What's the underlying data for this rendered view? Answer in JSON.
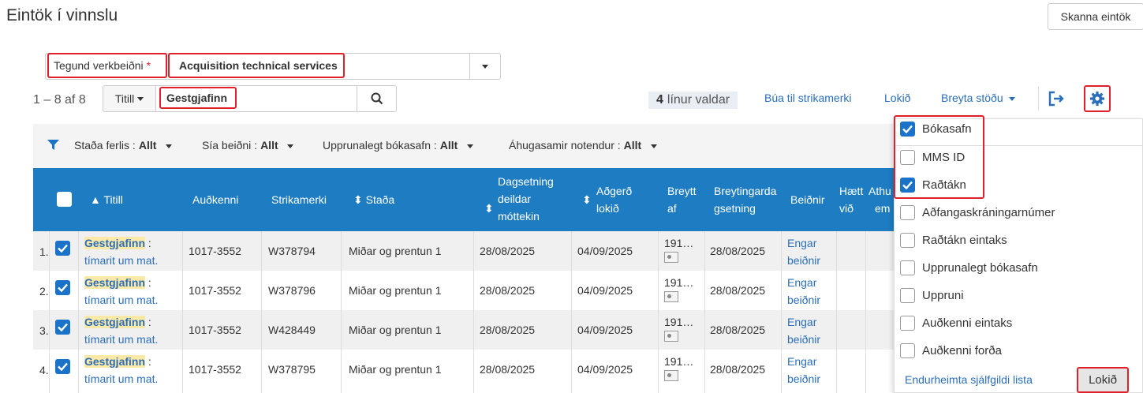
{
  "page_title": "Eintök í vinnslu",
  "scan_button": "Skanna eintök",
  "request_type": {
    "label": "Tegund verkbeiðni",
    "required": "*",
    "value": "Acquisition technical services"
  },
  "count": "1 – 8 af 8",
  "search": {
    "type": "Titill",
    "value": "Gestgjafinn"
  },
  "selected": {
    "num": "4",
    "text": "línur valdar"
  },
  "actions": {
    "barcode": "Búa til strikamerki",
    "done": "Lokið",
    "status": "Breyta stöðu"
  },
  "filters": [
    {
      "label": "Staða ferlis :",
      "value": "Allt"
    },
    {
      "label": "Sía beiðni :",
      "value": "Allt"
    },
    {
      "label": "Upprunalegt bókasafn :",
      "value": "Allt"
    },
    {
      "label": "Áhugasamir notendur :",
      "value": "Allt"
    }
  ],
  "columns": {
    "title": "Titill",
    "id": "Auðkenni",
    "barcode": "Strikamerki",
    "status": "Staða",
    "date1": [
      "Dagsetning",
      "deildar",
      "móttekin"
    ],
    "date2": [
      "Aðgerð",
      "lokið"
    ],
    "changed_by": [
      "Breytt",
      "af"
    ],
    "change_date": [
      "Breytingarda",
      "gsetning"
    ],
    "requests": "Beiðnir",
    "stopped": [
      "Hætt",
      "við"
    ],
    "notes": [
      "Athu",
      "em"
    ]
  },
  "rows": [
    {
      "num": "1.",
      "title_hl": "Gestgjafinn",
      "title_rest": ":",
      "subtitle": "tímarit um mat.",
      "id": "1017-3552",
      "barcode": "W378794",
      "status": "Miðar og prentun 1",
      "date1": "28/08/2025",
      "date2": "04/09/2025",
      "changed_by": "191…",
      "change_date": "28/08/2025",
      "req1": "Engar",
      "req2": "beiðnir"
    },
    {
      "num": "2.",
      "title_hl": "Gestgjafinn",
      "title_rest": ":",
      "subtitle": "tímarit um mat.",
      "id": "1017-3552",
      "barcode": "W378796",
      "status": "Miðar og prentun 1",
      "date1": "28/08/2025",
      "date2": "04/09/2025",
      "changed_by": "191…",
      "change_date": "28/08/2025",
      "req1": "Engar",
      "req2": "beiðnir"
    },
    {
      "num": "3.",
      "title_hl": "Gestgjafinn",
      "title_rest": ":",
      "subtitle": "tímarit um mat.",
      "id": "1017-3552",
      "barcode": "W428449",
      "status": "Miðar og prentun 1",
      "date1": "28/08/2025",
      "date2": "04/09/2025",
      "changed_by": "191…",
      "change_date": "28/08/2025",
      "req1": "Engar",
      "req2": "beiðnir"
    },
    {
      "num": "4.",
      "title_hl": "Gestgjafinn",
      "title_rest": ":",
      "subtitle": "tímarit um mat.",
      "id": "1017-3552",
      "barcode": "W378795",
      "status": "Miðar og prentun 1",
      "date1": "28/08/2025",
      "date2": "04/09/2025",
      "changed_by": "191…",
      "change_date": "28/08/2025",
      "req1": "Engar",
      "req2": "beiðnir"
    }
  ],
  "column_panel": {
    "options": [
      {
        "label": "Bókasafn",
        "checked": true
      },
      {
        "label": "MMS ID",
        "checked": false
      },
      {
        "label": "Raðtákn",
        "checked": true
      },
      {
        "label": "Aðfangaskráningarnúmer",
        "checked": false
      },
      {
        "label": "Raðtákn eintaks",
        "checked": false
      },
      {
        "label": "Upprunalegt bókasafn",
        "checked": false
      },
      {
        "label": "Uppruni",
        "checked": false
      },
      {
        "label": "Auðkenni eintaks",
        "checked": false
      },
      {
        "label": "Auðkenni forða",
        "checked": false
      }
    ],
    "reset": "Endurheimta sjálfgildi lista",
    "done": "Lokið"
  },
  "colors": {
    "header_blue": "#1e7dc2",
    "link": "#2a6ebb",
    "highlight": "#e0202a",
    "checkbox": "#1a73c9"
  }
}
